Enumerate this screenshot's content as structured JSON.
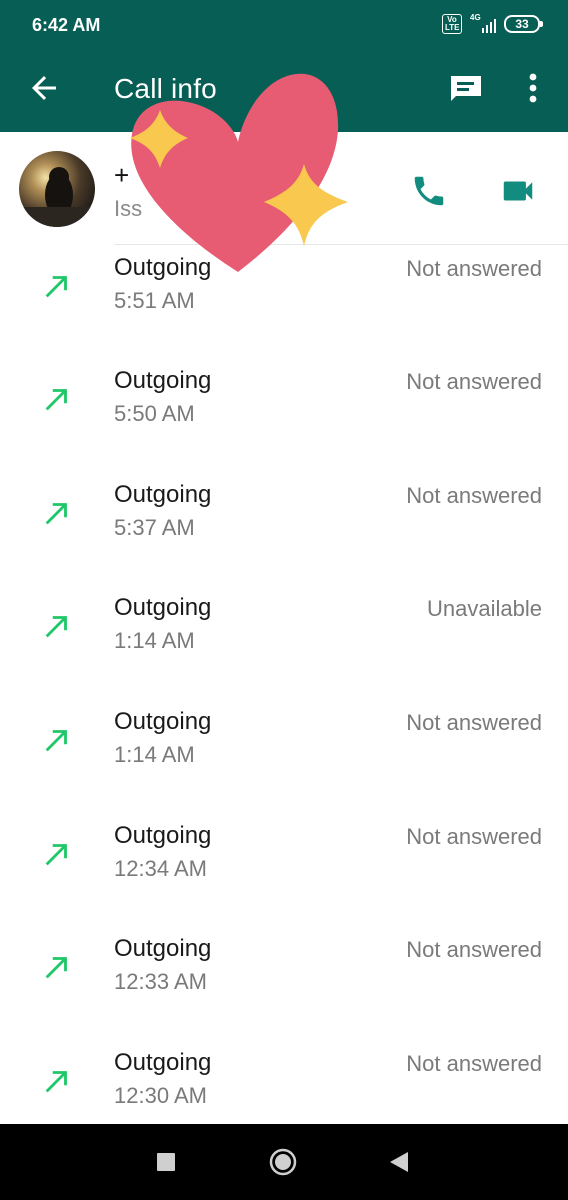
{
  "status_bar": {
    "time": "6:42 AM",
    "volte_label": "Vo LTE",
    "network_label": "4G",
    "battery_level": "33"
  },
  "app_bar": {
    "title": "Call info",
    "icons": [
      "back-arrow-icon",
      "message-icon",
      "more-vert-icon"
    ]
  },
  "contact": {
    "name": "+",
    "subtitle_start": "Iss",
    "subtitle_end": "...",
    "actions": [
      "phone-icon",
      "videocam-icon"
    ]
  },
  "calls": [
    {
      "type": "Outgoing",
      "time": "5:51 AM",
      "status": "Not answered"
    },
    {
      "type": "Outgoing",
      "time": "5:50 AM",
      "status": "Not answered"
    },
    {
      "type": "Outgoing",
      "time": "5:37 AM",
      "status": "Not answered"
    },
    {
      "type": "Outgoing",
      "time": "1:14 AM",
      "status": "Unavailable"
    },
    {
      "type": "Outgoing",
      "time": "1:14 AM",
      "status": "Not answered"
    },
    {
      "type": "Outgoing",
      "time": "12:34 AM",
      "status": "Not answered"
    },
    {
      "type": "Outgoing",
      "time": "12:33 AM",
      "status": "Not answered"
    },
    {
      "type": "Outgoing",
      "time": "12:30 AM",
      "status": "Not answered"
    }
  ],
  "colors": {
    "header": "#075e54",
    "accent": "#128c7e",
    "outgoing_arrow": "#1fc768",
    "heart": "#e85c73",
    "sparkle": "#f8c94e"
  },
  "nav_bar": {
    "icons": [
      "recents-square-icon",
      "home-circle-icon",
      "back-triangle-icon"
    ]
  }
}
